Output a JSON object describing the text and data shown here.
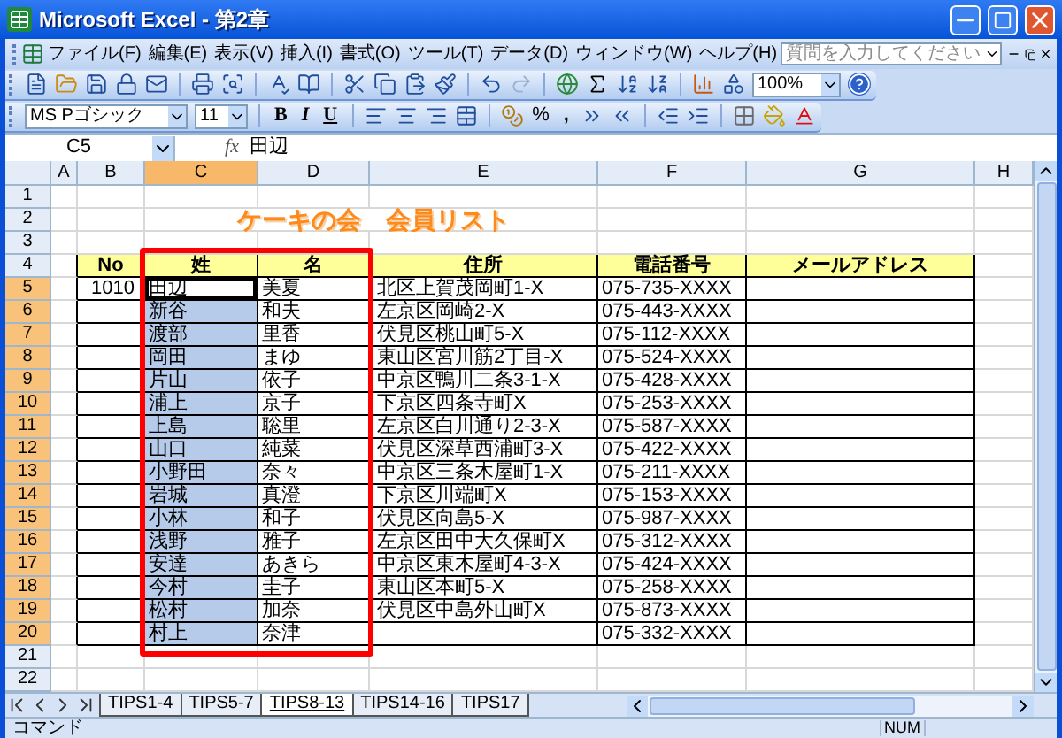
{
  "window": {
    "title": "Microsoft Excel - 第2章"
  },
  "menu": [
    "ファイル(F)",
    "編集(E)",
    "表示(V)",
    "挿入(I)",
    "書式(O)",
    "ツール(T)",
    "データ(D)",
    "ウィンドウ(W)",
    "ヘルプ(H)"
  ],
  "help_search": {
    "placeholder": "質問を入力してください"
  },
  "standard_toolbar": {
    "zoom": "100%"
  },
  "formatting_toolbar": {
    "font": "MS Pゴシック",
    "size": "11",
    "bold": "B",
    "italic": "I",
    "underline": "U",
    "percent": "%",
    "comma": ","
  },
  "formula_bar": {
    "name_box": "C5",
    "function_label": "fx",
    "value": "田辺"
  },
  "columns": [
    {
      "label": "A",
      "selected": false
    },
    {
      "label": "B",
      "selected": false
    },
    {
      "label": "C",
      "selected": true
    },
    {
      "label": "D",
      "selected": false
    },
    {
      "label": "E",
      "selected": false
    },
    {
      "label": "F",
      "selected": false
    },
    {
      "label": "G",
      "selected": false
    },
    {
      "label": "H",
      "selected": false
    }
  ],
  "rows": [
    {
      "number": "1",
      "kind": "blank",
      "selected": false,
      "active": false
    },
    {
      "number": "2",
      "kind": "title",
      "selected": false,
      "active": false,
      "title": "ケーキの会　会員リスト"
    },
    {
      "number": "3",
      "kind": "blank",
      "selected": false,
      "active": false
    },
    {
      "number": "4",
      "kind": "header",
      "selected": false,
      "active": false,
      "cells": {
        "B": "No",
        "C": "姓",
        "D": "名",
        "E": "住所",
        "F": "電話番号",
        "G": "メールアドレス"
      }
    },
    {
      "number": "5",
      "kind": "data",
      "selected": true,
      "active": true,
      "cells": {
        "B": "1010",
        "C": "田辺",
        "D": "美夏",
        "E": "北区上賀茂岡町1-X",
        "F": "075-735-XXXX"
      }
    },
    {
      "number": "6",
      "kind": "data",
      "selected": true,
      "active": false,
      "cells": {
        "C": "新谷",
        "D": "和夫",
        "E": "左京区岡崎2-X",
        "F": "075-443-XXXX"
      }
    },
    {
      "number": "7",
      "kind": "data",
      "selected": true,
      "active": false,
      "cells": {
        "C": "渡部",
        "D": "里香",
        "E": "伏見区桃山町5-X",
        "F": "075-112-XXXX"
      }
    },
    {
      "number": "8",
      "kind": "data",
      "selected": true,
      "active": false,
      "cells": {
        "C": "岡田",
        "D": "まゆ",
        "E": "東山区宮川筋2丁目-X",
        "F": "075-524-XXXX"
      }
    },
    {
      "number": "9",
      "kind": "data",
      "selected": true,
      "active": false,
      "cells": {
        "C": "片山",
        "D": "依子",
        "E": "中京区鴨川二条3-1-X",
        "F": "075-428-XXXX"
      }
    },
    {
      "number": "10",
      "kind": "data",
      "selected": true,
      "active": false,
      "cells": {
        "C": "浦上",
        "D": "京子",
        "E": "下京区四条寺町X",
        "F": "075-253-XXXX"
      }
    },
    {
      "number": "11",
      "kind": "data",
      "selected": true,
      "active": false,
      "cells": {
        "C": "上島",
        "D": "聡里",
        "E": "左京区白川通り2-3-X",
        "F": "075-587-XXXX"
      }
    },
    {
      "number": "12",
      "kind": "data",
      "selected": true,
      "active": false,
      "cells": {
        "C": "山口",
        "D": "純菜",
        "E": "伏見区深草西浦町3-X",
        "F": "075-422-XXXX"
      }
    },
    {
      "number": "13",
      "kind": "data",
      "selected": true,
      "active": false,
      "cells": {
        "C": "小野田",
        "D": "奈々",
        "E": "中京区三条木屋町1-X",
        "F": "075-211-XXXX"
      }
    },
    {
      "number": "14",
      "kind": "data",
      "selected": true,
      "active": false,
      "cells": {
        "C": "岩城",
        "D": "真澄",
        "E": "下京区川端町X",
        "F": "075-153-XXXX"
      }
    },
    {
      "number": "15",
      "kind": "data",
      "selected": true,
      "active": false,
      "cells": {
        "C": "小林",
        "D": "和子",
        "E": "伏見区向島5-X",
        "F": "075-987-XXXX"
      }
    },
    {
      "number": "16",
      "kind": "data",
      "selected": true,
      "active": false,
      "cells": {
        "C": "浅野",
        "D": "雅子",
        "E": "左京区田中大久保町X",
        "F": "075-312-XXXX"
      }
    },
    {
      "number": "17",
      "kind": "data",
      "selected": true,
      "active": false,
      "cells": {
        "C": "安達",
        "D": "あきら",
        "E": "中京区東木屋町4-3-X",
        "F": "075-424-XXXX"
      }
    },
    {
      "number": "18",
      "kind": "data",
      "selected": true,
      "active": false,
      "cells": {
        "C": "今村",
        "D": "圭子",
        "E": "東山区本町5-X",
        "F": "075-258-XXXX"
      }
    },
    {
      "number": "19",
      "kind": "data",
      "selected": true,
      "active": false,
      "cells": {
        "C": "松村",
        "D": "加奈",
        "E": "伏見区中島外山町X",
        "F": "075-873-XXXX"
      }
    },
    {
      "number": "20",
      "kind": "data",
      "selected": true,
      "active": false,
      "cells": {
        "C": "村上",
        "D": "奈津",
        "F": "075-332-XXXX"
      }
    },
    {
      "number": "21",
      "kind": "blank",
      "selected": false,
      "active": false
    },
    {
      "number": "22",
      "kind": "blank",
      "selected": false,
      "active": false
    }
  ],
  "sheet_tabs": [
    {
      "label": "TIPS1-4",
      "selected": false
    },
    {
      "label": "TIPS5-7",
      "selected": false
    },
    {
      "label": "TIPS8-13",
      "selected": true
    },
    {
      "label": "TIPS14-16",
      "selected": false
    },
    {
      "label": "TIPS17",
      "selected": false
    }
  ],
  "status_bar": {
    "mode": "コマンド",
    "num": "NUM"
  }
}
